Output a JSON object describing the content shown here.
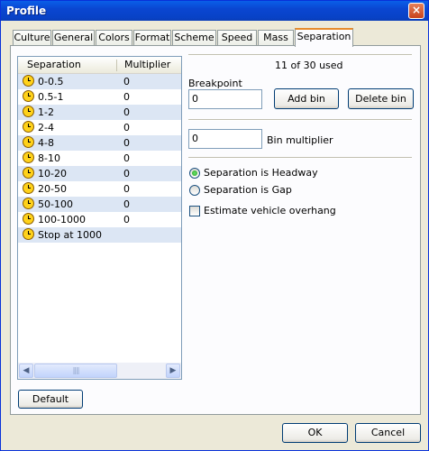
{
  "window": {
    "title": "Profile",
    "close_glyph": "×"
  },
  "tabs": [
    {
      "label": "Culture"
    },
    {
      "label": "General"
    },
    {
      "label": "Colors"
    },
    {
      "label": "Format"
    },
    {
      "label": "Scheme"
    },
    {
      "label": "Speed"
    },
    {
      "label": "Mass"
    },
    {
      "label": "Separation",
      "active": true
    }
  ],
  "list": {
    "columns": [
      "Separation",
      "Multiplier"
    ],
    "rows": [
      {
        "label": "0-0.5",
        "value": "0"
      },
      {
        "label": "0.5-1",
        "value": "0"
      },
      {
        "label": "1-2",
        "value": "0"
      },
      {
        "label": "2-4",
        "value": "0"
      },
      {
        "label": "4-8",
        "value": "0"
      },
      {
        "label": "8-10",
        "value": "0"
      },
      {
        "label": "10-20",
        "value": "0"
      },
      {
        "label": "20-50",
        "value": "0"
      },
      {
        "label": "50-100",
        "value": "0"
      },
      {
        "label": "100-1000",
        "value": "0"
      },
      {
        "label": "Stop at 1000",
        "value": ""
      }
    ],
    "scroll_left": "◀",
    "scroll_right": "▶",
    "thumb_grip": "||||"
  },
  "used_count": "11 of 30 used",
  "breakpoint": {
    "label": "Breakpoint",
    "value": "0"
  },
  "add_bin_label": "Add bin",
  "delete_bin_label": "Delete bin",
  "bin_multiplier": {
    "value": "0",
    "label": "Bin multiplier"
  },
  "radio_headway_label": "Separation is Headway",
  "radio_gap_label": "Separation is Gap",
  "estimate_overhang_label": "Estimate vehicle overhang",
  "default_label": "Default",
  "ok_label": "OK",
  "cancel_label": "Cancel"
}
